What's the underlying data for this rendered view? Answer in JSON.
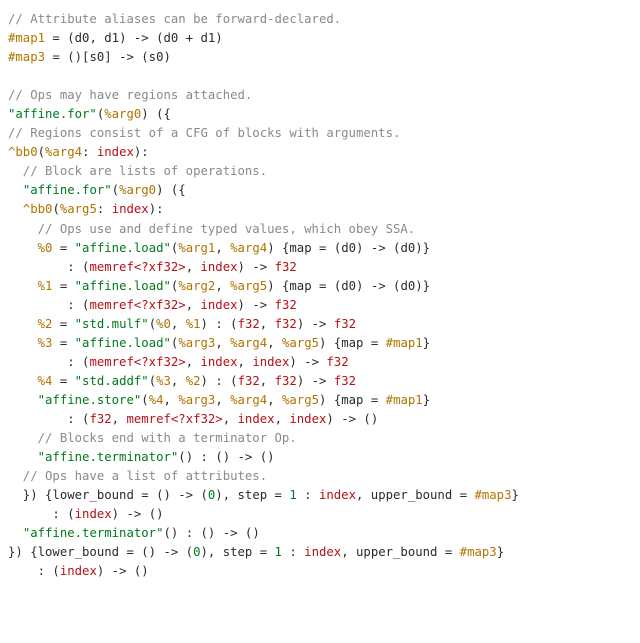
{
  "lines": {
    "l01a": "// Attribute aliases can be forward-declared.",
    "l02a": "#map1",
    "l02b": " = (d0, d1) -> (d0 + d1)",
    "l03a": "#map3",
    "l03b": " = ()[s0] -> (s0)",
    "l05a": "// Ops may have regions attached.",
    "l06a": "\"affine.for\"",
    "l06b": "(",
    "l06c": "%arg0",
    "l06d": ") ({",
    "l07a": "// Regions consist of a CFG of blocks with arguments.",
    "l08a": "^bb0",
    "l08b": "(",
    "l08c": "%arg4",
    "l08d": ": ",
    "l08e": "index",
    "l08f": "):",
    "l09a": "  // Block are lists of operations.",
    "l10a": "  ",
    "l10b": "\"affine.for\"",
    "l10c": "(",
    "l10d": "%arg0",
    "l10e": ") ({",
    "l11a": "  ",
    "l11b": "^bb0",
    "l11c": "(",
    "l11d": "%arg5",
    "l11e": ": ",
    "l11f": "index",
    "l11g": "):",
    "l12a": "    // Ops use and define typed values, which obey SSA.",
    "l13a": "    ",
    "l13b": "%0",
    "l13c": " = ",
    "l13d": "\"affine.load\"",
    "l13e": "(",
    "l13f": "%arg1",
    "l13g": ", ",
    "l13h": "%arg4",
    "l13i": ") {map = (d0) -> (d0)}",
    "l14a": "        : (",
    "l14b": "memref<?xf32>",
    "l14c": ", ",
    "l14d": "index",
    "l14e": ") -> ",
    "l14f": "f32",
    "l15a": "    ",
    "l15b": "%1",
    "l15c": " = ",
    "l15d": "\"affine.load\"",
    "l15e": "(",
    "l15f": "%arg2",
    "l15g": ", ",
    "l15h": "%arg5",
    "l15i": ") {map = (d0) -> (d0)}",
    "l16a": "        : (",
    "l16b": "memref<?xf32>",
    "l16c": ", ",
    "l16d": "index",
    "l16e": ") -> ",
    "l16f": "f32",
    "l17a": "    ",
    "l17b": "%2",
    "l17c": " = ",
    "l17d": "\"std.mulf\"",
    "l17e": "(",
    "l17f": "%0",
    "l17g": ", ",
    "l17h": "%1",
    "l17i": ") : (",
    "l17j": "f32",
    "l17k": ", ",
    "l17l": "f32",
    "l17m": ") -> ",
    "l17n": "f32",
    "l18a": "    ",
    "l18b": "%3",
    "l18c": " = ",
    "l18d": "\"affine.load\"",
    "l18e": "(",
    "l18f": "%arg3",
    "l18g": ", ",
    "l18h": "%arg4",
    "l18i": ", ",
    "l18j": "%arg5",
    "l18k": ") {map = ",
    "l18l": "#map1",
    "l18m": "}",
    "l19a": "        : (",
    "l19b": "memref<?xf32>",
    "l19c": ", ",
    "l19d": "index",
    "l19e": ", ",
    "l19f": "index",
    "l19g": ") -> ",
    "l19h": "f32",
    "l20a": "    ",
    "l20b": "%4",
    "l20c": " = ",
    "l20d": "\"std.addf\"",
    "l20e": "(",
    "l20f": "%3",
    "l20g": ", ",
    "l20h": "%2",
    "l20i": ") : (",
    "l20j": "f32",
    "l20k": ", ",
    "l20l": "f32",
    "l20m": ") -> ",
    "l20n": "f32",
    "l21a": "    ",
    "l21b": "\"affine.store\"",
    "l21c": "(",
    "l21d": "%4",
    "l21e": ", ",
    "l21f": "%arg3",
    "l21g": ", ",
    "l21h": "%arg4",
    "l21i": ", ",
    "l21j": "%arg5",
    "l21k": ") {map = ",
    "l21l": "#map1",
    "l21m": "}",
    "l22a": "        : (",
    "l22b": "f32",
    "l22c": ", ",
    "l22d": "memref<?xf32>",
    "l22e": ", ",
    "l22f": "index",
    "l22g": ", ",
    "l22h": "index",
    "l22i": ") -> ()",
    "l23a": "    // Blocks end with a terminator Op.",
    "l24a": "    ",
    "l24b": "\"affine.terminator\"",
    "l24c": "() : () -> ()",
    "l25a": "  // Ops have a list of attributes.",
    "l26a": "  }) {lower_bound = () -> (",
    "l26b": "0",
    "l26c": "), step = ",
    "l26d": "1",
    "l26e": " : ",
    "l26f": "index",
    "l26g": ", upper_bound = ",
    "l26h": "#map3",
    "l26i": "}",
    "l27a": "      : (",
    "l27b": "index",
    "l27c": ") -> ()",
    "l28a": "  ",
    "l28b": "\"affine.terminator\"",
    "l28c": "() : () -> ()",
    "l29a": "}) {lower_bound = () -> (",
    "l29b": "0",
    "l29c": "), step = ",
    "l29d": "1",
    "l29e": " : ",
    "l29f": "index",
    "l29g": ", upper_bound = ",
    "l29h": "#map3",
    "l29i": "}",
    "l30a": "    : (",
    "l30b": "index",
    "l30c": ") -> ()"
  }
}
